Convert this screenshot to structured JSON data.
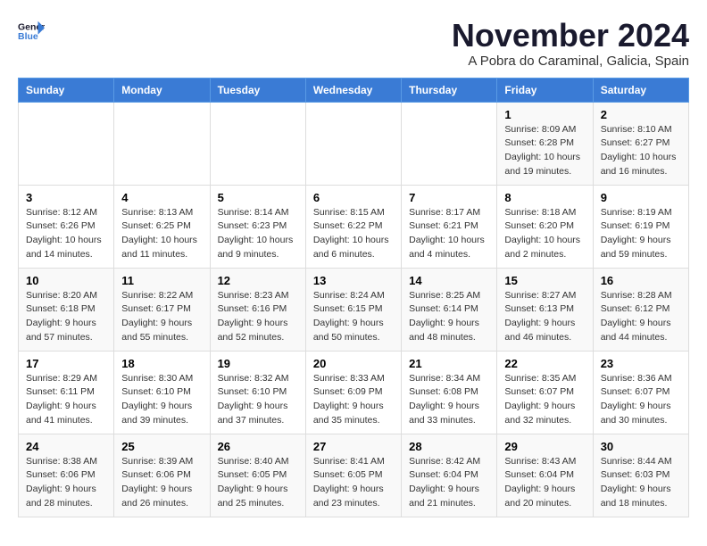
{
  "header": {
    "logo_line1": "General",
    "logo_line2": "Blue",
    "title": "November 2024",
    "subtitle": "A Pobra do Caraminal, Galicia, Spain"
  },
  "days_of_week": [
    "Sunday",
    "Monday",
    "Tuesday",
    "Wednesday",
    "Thursday",
    "Friday",
    "Saturday"
  ],
  "weeks": [
    [
      {
        "day": "",
        "info": ""
      },
      {
        "day": "",
        "info": ""
      },
      {
        "day": "",
        "info": ""
      },
      {
        "day": "",
        "info": ""
      },
      {
        "day": "",
        "info": ""
      },
      {
        "day": "1",
        "info": "Sunrise: 8:09 AM\nSunset: 6:28 PM\nDaylight: 10 hours and 19 minutes."
      },
      {
        "day": "2",
        "info": "Sunrise: 8:10 AM\nSunset: 6:27 PM\nDaylight: 10 hours and 16 minutes."
      }
    ],
    [
      {
        "day": "3",
        "info": "Sunrise: 8:12 AM\nSunset: 6:26 PM\nDaylight: 10 hours and 14 minutes."
      },
      {
        "day": "4",
        "info": "Sunrise: 8:13 AM\nSunset: 6:25 PM\nDaylight: 10 hours and 11 minutes."
      },
      {
        "day": "5",
        "info": "Sunrise: 8:14 AM\nSunset: 6:23 PM\nDaylight: 10 hours and 9 minutes."
      },
      {
        "day": "6",
        "info": "Sunrise: 8:15 AM\nSunset: 6:22 PM\nDaylight: 10 hours and 6 minutes."
      },
      {
        "day": "7",
        "info": "Sunrise: 8:17 AM\nSunset: 6:21 PM\nDaylight: 10 hours and 4 minutes."
      },
      {
        "day": "8",
        "info": "Sunrise: 8:18 AM\nSunset: 6:20 PM\nDaylight: 10 hours and 2 minutes."
      },
      {
        "day": "9",
        "info": "Sunrise: 8:19 AM\nSunset: 6:19 PM\nDaylight: 9 hours and 59 minutes."
      }
    ],
    [
      {
        "day": "10",
        "info": "Sunrise: 8:20 AM\nSunset: 6:18 PM\nDaylight: 9 hours and 57 minutes."
      },
      {
        "day": "11",
        "info": "Sunrise: 8:22 AM\nSunset: 6:17 PM\nDaylight: 9 hours and 55 minutes."
      },
      {
        "day": "12",
        "info": "Sunrise: 8:23 AM\nSunset: 6:16 PM\nDaylight: 9 hours and 52 minutes."
      },
      {
        "day": "13",
        "info": "Sunrise: 8:24 AM\nSunset: 6:15 PM\nDaylight: 9 hours and 50 minutes."
      },
      {
        "day": "14",
        "info": "Sunrise: 8:25 AM\nSunset: 6:14 PM\nDaylight: 9 hours and 48 minutes."
      },
      {
        "day": "15",
        "info": "Sunrise: 8:27 AM\nSunset: 6:13 PM\nDaylight: 9 hours and 46 minutes."
      },
      {
        "day": "16",
        "info": "Sunrise: 8:28 AM\nSunset: 6:12 PM\nDaylight: 9 hours and 44 minutes."
      }
    ],
    [
      {
        "day": "17",
        "info": "Sunrise: 8:29 AM\nSunset: 6:11 PM\nDaylight: 9 hours and 41 minutes."
      },
      {
        "day": "18",
        "info": "Sunrise: 8:30 AM\nSunset: 6:10 PM\nDaylight: 9 hours and 39 minutes."
      },
      {
        "day": "19",
        "info": "Sunrise: 8:32 AM\nSunset: 6:10 PM\nDaylight: 9 hours and 37 minutes."
      },
      {
        "day": "20",
        "info": "Sunrise: 8:33 AM\nSunset: 6:09 PM\nDaylight: 9 hours and 35 minutes."
      },
      {
        "day": "21",
        "info": "Sunrise: 8:34 AM\nSunset: 6:08 PM\nDaylight: 9 hours and 33 minutes."
      },
      {
        "day": "22",
        "info": "Sunrise: 8:35 AM\nSunset: 6:07 PM\nDaylight: 9 hours and 32 minutes."
      },
      {
        "day": "23",
        "info": "Sunrise: 8:36 AM\nSunset: 6:07 PM\nDaylight: 9 hours and 30 minutes."
      }
    ],
    [
      {
        "day": "24",
        "info": "Sunrise: 8:38 AM\nSunset: 6:06 PM\nDaylight: 9 hours and 28 minutes."
      },
      {
        "day": "25",
        "info": "Sunrise: 8:39 AM\nSunset: 6:06 PM\nDaylight: 9 hours and 26 minutes."
      },
      {
        "day": "26",
        "info": "Sunrise: 8:40 AM\nSunset: 6:05 PM\nDaylight: 9 hours and 25 minutes."
      },
      {
        "day": "27",
        "info": "Sunrise: 8:41 AM\nSunset: 6:05 PM\nDaylight: 9 hours and 23 minutes."
      },
      {
        "day": "28",
        "info": "Sunrise: 8:42 AM\nSunset: 6:04 PM\nDaylight: 9 hours and 21 minutes."
      },
      {
        "day": "29",
        "info": "Sunrise: 8:43 AM\nSunset: 6:04 PM\nDaylight: 9 hours and 20 minutes."
      },
      {
        "day": "30",
        "info": "Sunrise: 8:44 AM\nSunset: 6:03 PM\nDaylight: 9 hours and 18 minutes."
      }
    ]
  ]
}
